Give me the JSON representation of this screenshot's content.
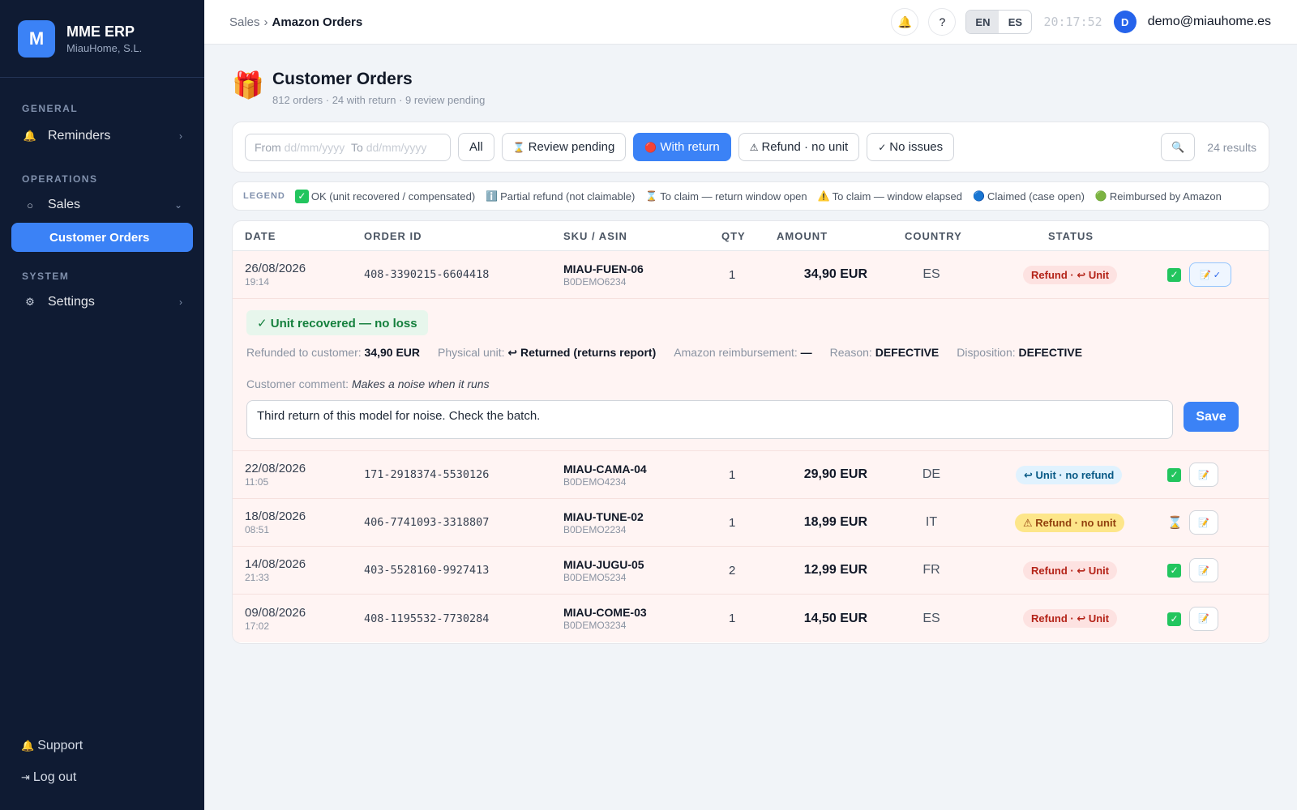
{
  "brand": {
    "logo_letter": "M",
    "name": "MME ERP",
    "company": "MiauHome, S.L."
  },
  "sidebar": {
    "sections": [
      {
        "label": "GENERAL"
      },
      {
        "label": "OPERATIONS"
      },
      {
        "label": "SYSTEM"
      }
    ],
    "items": [
      {
        "label": "Reminders",
        "icon": "bell-icon"
      },
      {
        "label": "Sales",
        "icon": "circle-icon"
      },
      {
        "label": "Customer Orders"
      },
      {
        "label": "Settings",
        "icon": "gear-icon"
      }
    ],
    "support_label": "Support",
    "logout_label": "Log out"
  },
  "topbar": {
    "breadcrumb": [
      "Sales",
      "Amazon Orders"
    ],
    "help_label": "?",
    "langs": [
      "EN",
      "ES"
    ],
    "active_lang": "EN",
    "clock": "20:17:52",
    "avatar_letter": "D",
    "user_email": "demo@miauhome.es"
  },
  "page": {
    "icon": "gift-icon",
    "title": "Customer Orders",
    "subtitle": "812 orders · 24 with return · 9 review pending"
  },
  "filters": {
    "from_label": "From",
    "from_placeholder": "dd/mm/yyyy",
    "to_label": "To",
    "to_placeholder": "dd/mm/yyyy",
    "buttons": [
      {
        "label": "All"
      },
      {
        "label": "Review pending",
        "icon": "hourglass-icon"
      },
      {
        "label": "With return",
        "icon": "red-dot-icon"
      },
      {
        "label": "Refund · no unit",
        "icon": "warning-icon"
      },
      {
        "label": "No issues",
        "icon": "check-icon"
      }
    ],
    "active_filter": "With return",
    "results_text": "24 results"
  },
  "legend": {
    "title": "LEGEND",
    "items": [
      {
        "icon": "green-check-icon",
        "label": "OK (unit recovered / compensated)"
      },
      {
        "icon": "info-icon",
        "label": "Partial refund (not claimable)"
      },
      {
        "icon": "hourglass-icon",
        "label": "To claim — return window open"
      },
      {
        "icon": "warning-icon",
        "label": "To claim — window elapsed"
      },
      {
        "icon": "blue-dot-icon",
        "label": "Claimed (case open)"
      },
      {
        "icon": "green-dot-icon",
        "label": "Reimbursed by Amazon"
      }
    ]
  },
  "table": {
    "headers": [
      "DATE",
      "ORDER ID",
      "SKU / ASIN",
      "QTY",
      "AMOUNT",
      "COUNTRY",
      "STATUS"
    ],
    "rows": [
      {
        "date": "26/08/2026",
        "time": "19:14",
        "order_id": "408-3390215-6604418",
        "sku": "MIAU-FUEN-06",
        "asin": "B0DEMO6234",
        "qty": "1",
        "amount": "34,90 EUR",
        "country": "ES",
        "status": "Refund · ↩ Unit",
        "status_color": "red",
        "ok_icon": "green-check-icon",
        "note_label": "✓"
      },
      {
        "date": "22/08/2026",
        "time": "11:05",
        "order_id": "171-2918374-5530126",
        "sku": "MIAU-CAMA-04",
        "asin": "B0DEMO4234",
        "qty": "1",
        "amount": "29,90 EUR",
        "country": "DE",
        "status": "↩ Unit · no refund",
        "status_color": "blue",
        "ok_icon": "green-check-icon"
      },
      {
        "date": "18/08/2026",
        "time": "08:51",
        "order_id": "406-7741093-3318807",
        "sku": "MIAU-TUNE-02",
        "asin": "B0DEMO2234",
        "qty": "1",
        "amount": "18,99 EUR",
        "country": "IT",
        "status": "⚠ Refund · no unit",
        "status_color": "yellow",
        "ok_icon": "hourglass-icon"
      },
      {
        "date": "14/08/2026",
        "time": "21:33",
        "order_id": "403-5528160-9927413",
        "sku": "MIAU-JUGU-05",
        "asin": "B0DEMO5234",
        "qty": "2",
        "amount": "12,99 EUR",
        "country": "FR",
        "status": "Refund · ↩ Unit",
        "status_color": "red",
        "ok_icon": "green-check-icon"
      },
      {
        "date": "09/08/2026",
        "time": "17:02",
        "order_id": "408-1195532-7730284",
        "sku": "MIAU-COME-03",
        "asin": "B0DEMO3234",
        "qty": "1",
        "amount": "14,50 EUR",
        "country": "ES",
        "status": "Refund · ↩ Unit",
        "status_color": "red",
        "ok_icon": "green-check-icon"
      }
    ]
  },
  "detail": {
    "recovered": "✓ Unit recovered — no loss",
    "refunded_label": "Refunded to customer:",
    "refunded_value": "34,90 EUR",
    "physical_label": "Physical unit:",
    "physical_value": "↩ Returned (returns report)",
    "reimb_label": "Amazon reimbursement:",
    "reimb_value": "—",
    "reason_label": "Reason:",
    "reason_value": "DEFECTIVE",
    "disposition_label": "Disposition:",
    "disposition_value": "DEFECTIVE",
    "comment_label": "Customer comment:",
    "comment_value": "Makes a noise when it runs",
    "note_value": "Third return of this model for noise. Check the batch.",
    "save_label": "Save"
  },
  "colors": {
    "accent": "#3b82f6",
    "sidebar_bg": "#0f1b33",
    "row_bg": "#fff4f3"
  }
}
